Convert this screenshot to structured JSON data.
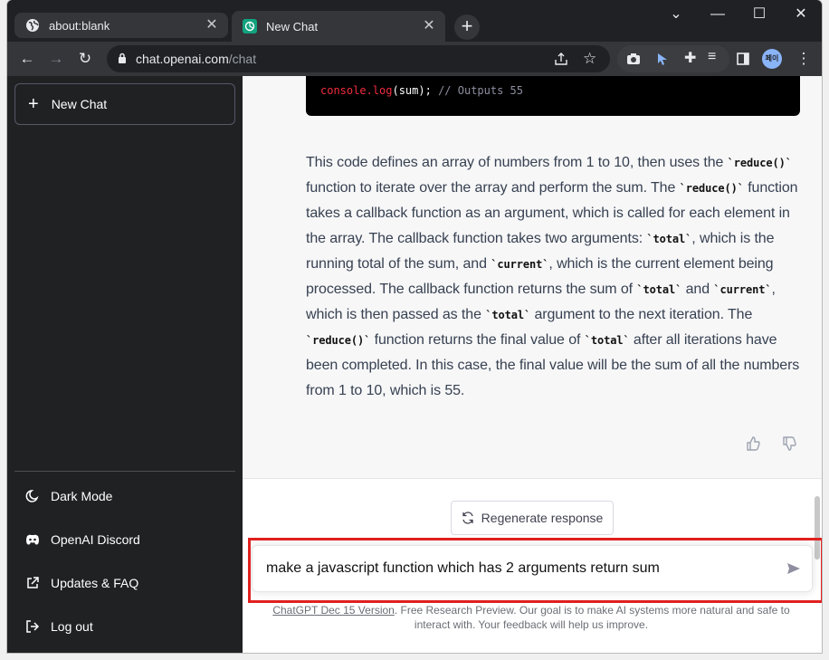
{
  "browser": {
    "tabs": [
      {
        "label": "about:blank",
        "active": false
      },
      {
        "label": "New Chat",
        "active": true
      }
    ],
    "url_host": "chat.openai.com",
    "url_path": "/chat",
    "profile_initials": "페이"
  },
  "sidebar": {
    "new_chat_label": "New Chat",
    "items": [
      {
        "label": "Dark Mode",
        "icon": "moon-icon"
      },
      {
        "label": "OpenAI Discord",
        "icon": "discord-icon"
      },
      {
        "label": "Updates & FAQ",
        "icon": "external-link-icon"
      },
      {
        "label": "Log out",
        "icon": "logout-icon"
      }
    ]
  },
  "code": {
    "fn": "console.log",
    "arg": "(sum);",
    "comment": "// Outputs 55"
  },
  "answer": {
    "segments": [
      "This code defines an array of numbers from 1 to 10, then uses the ",
      "`reduce()`",
      " function to iterate over the array and perform the sum. The ",
      "`reduce()`",
      " function takes a callback function as an argument, which is called for each element in the array. The callback function takes two arguments: ",
      "`total`",
      ", which is the running total of the sum, and ",
      "`current`",
      ", which is the current element being processed. The callback function returns the sum of ",
      "`total`",
      " and ",
      "`current`",
      ", which is then passed as the ",
      "`total`",
      " argument to the next iteration. The ",
      "`reduce()`",
      " function returns the final value of ",
      "`total`",
      " after all iterations have been completed. In this case, the final value will be the sum of all the numbers from 1 to 10, which is 55."
    ]
  },
  "regenerate_label": "Regenerate response",
  "prompt_value": "make a javascript function which has 2 arguments return sum",
  "footer": {
    "link": "ChatGPT Dec 15 Version",
    "text": ". Free Research Preview. Our goal is to make AI systems more natural and safe to interact with. Your feedback will help us improve."
  },
  "colors": {
    "sidebar_bg": "#202123",
    "highlight_border": "#e0201f",
    "answer_bg": "#f7f7f8"
  }
}
